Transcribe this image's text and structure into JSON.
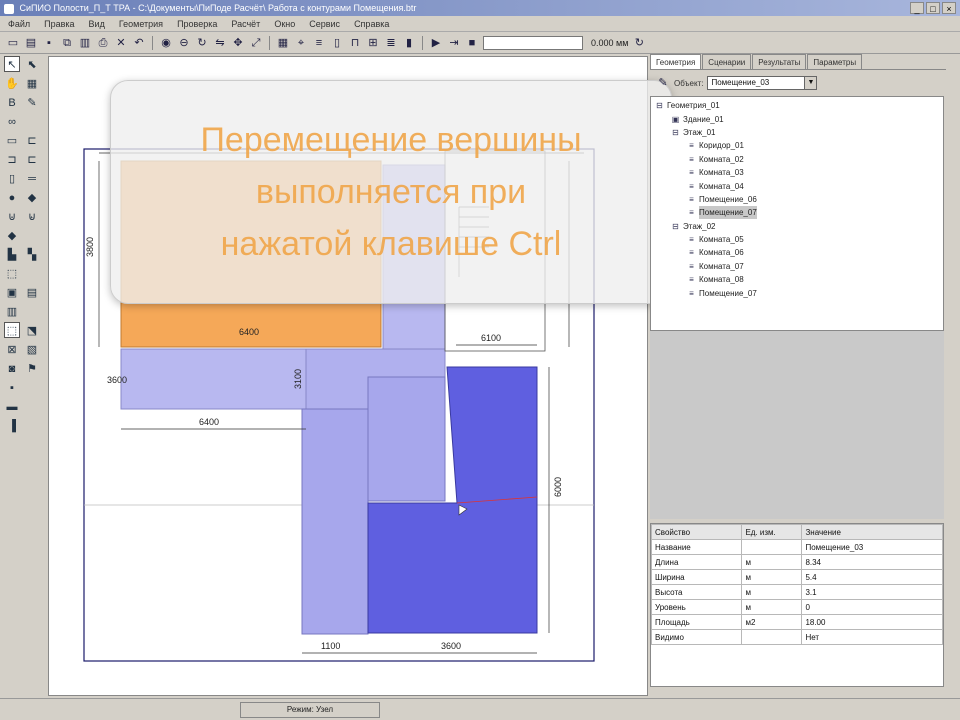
{
  "window": {
    "title": "СиПИО Полости_П_Т ТРА - С:\\Документы\\ПиПоде Расчёт\\ Работа с контурами Помещения.btr",
    "buttons": [
      "_",
      "□",
      "×"
    ]
  },
  "menu": [
    "Файл",
    "Правка",
    "Вид",
    "Геометрия",
    "Проверка",
    "Расчёт",
    "Окно",
    "Сервис",
    "Справка"
  ],
  "toolbar": {
    "icons": [
      "new-icon",
      "open-icon",
      "save-icon",
      "copy-icon",
      "paste-icon",
      "print-icon",
      "delete-icon",
      "undo-icon",
      "circle-icon",
      "ellipse-icon",
      "rotate-icon",
      "mirror-icon",
      "move-icon",
      "scale-icon",
      "grid-icon",
      "snap-icon",
      "align-icon",
      "wall-icon",
      "door-icon",
      "window-icon",
      "stair-icon",
      "column-icon",
      "play-icon",
      "step-icon",
      "stop-icon"
    ],
    "coord_value": "0.000 мм",
    "glyphs": {
      "new-icon": "▭",
      "open-icon": "▤",
      "save-icon": "▪",
      "copy-icon": "⧉",
      "paste-icon": "▥",
      "print-icon": "⎙",
      "delete-icon": "✕",
      "undo-icon": "↶",
      "circle-icon": "◉",
      "ellipse-icon": "⊖",
      "rotate-icon": "↻",
      "mirror-icon": "⇋",
      "move-icon": "✥",
      "scale-icon": "⤢",
      "grid-icon": "▦",
      "snap-icon": "⌖",
      "align-icon": "≡",
      "wall-icon": "▯",
      "door-icon": "⊓",
      "window-icon": "⊞",
      "stair-icon": "≣",
      "column-icon": "▮",
      "play-icon": "▶",
      "step-icon": "⇥",
      "stop-icon": "■"
    }
  },
  "left_tools": [
    {
      "name": "select-arrow-icon",
      "glyph": "↖",
      "active": true
    },
    {
      "name": "node-edit-icon",
      "glyph": "⬉",
      "active": false
    },
    {
      "name": "pan-icon",
      "glyph": "✋",
      "active": false
    },
    {
      "name": "zoom-icon",
      "glyph": "▦",
      "active": false
    },
    {
      "name": "building-icon",
      "glyph": "В",
      "active": false
    },
    {
      "name": "pencil-icon",
      "glyph": "✎",
      "active": false
    },
    {
      "name": "link-icon",
      "glyph": "∞",
      "active": false
    },
    {
      "name": "blank",
      "glyph": "",
      "active": false
    },
    {
      "name": "room-icon",
      "glyph": "▭",
      "active": false
    },
    {
      "name": "zone-icon",
      "glyph": "⊏",
      "active": false
    },
    {
      "name": "wall-tool-icon",
      "glyph": "⊐",
      "active": false
    },
    {
      "name": "contour-icon",
      "glyph": "⊏",
      "active": false
    },
    {
      "name": "column-tool-icon",
      "glyph": "▯",
      "active": false
    },
    {
      "name": "line-tool-icon",
      "glyph": "═",
      "active": false
    },
    {
      "name": "point-icon",
      "glyph": "●",
      "active": false
    },
    {
      "name": "marker-icon",
      "glyph": "◆",
      "active": false
    },
    {
      "name": "door-tool-icon",
      "glyph": "⊍",
      "active": false
    },
    {
      "name": "opening-icon",
      "glyph": "⊌",
      "active": false
    },
    {
      "name": "fill-icon",
      "glyph": "◆",
      "active": false
    },
    {
      "name": "blank2",
      "glyph": "",
      "active": false
    },
    {
      "name": "height-icon",
      "glyph": "▙",
      "active": false
    },
    {
      "name": "level-icon",
      "glyph": "▚",
      "active": false
    },
    {
      "name": "eraser-icon",
      "glyph": "⬚",
      "active": false
    },
    {
      "name": "blank3",
      "glyph": "",
      "active": false
    },
    {
      "name": "calc-icon",
      "glyph": "▣",
      "active": false
    },
    {
      "name": "sensor-icon",
      "glyph": "▤",
      "active": false
    },
    {
      "name": "chart-icon",
      "glyph": "▥",
      "active": false
    },
    {
      "name": "blank4",
      "glyph": "",
      "active": false
    },
    {
      "name": "rect-select-icon",
      "glyph": "⬚",
      "active": true
    },
    {
      "name": "poly-select-icon",
      "glyph": "⬔",
      "active": false
    },
    {
      "name": "fire-icon",
      "glyph": "⊠",
      "active": false
    },
    {
      "name": "exit-icon",
      "glyph": "▧",
      "active": false
    },
    {
      "name": "person-icon",
      "glyph": "◙",
      "active": false
    },
    {
      "name": "flag-icon",
      "glyph": "⚑",
      "active": false
    },
    {
      "name": "info-icon",
      "glyph": "▪",
      "active": false
    },
    {
      "name": "blank5",
      "glyph": "",
      "active": false
    },
    {
      "name": "extra-icon",
      "glyph": "▬",
      "active": false
    },
    {
      "name": "blank6",
      "glyph": "",
      "active": false
    },
    {
      "name": "exit-app-icon",
      "glyph": "▐",
      "active": false
    }
  ],
  "overlay": {
    "lines": [
      "Перемещение вершины",
      "выполняется при",
      "нажатой клавише Ctrl"
    ]
  },
  "dimensions": {
    "d1": "6400",
    "d2": "3800",
    "d3": "6400",
    "d4": "6100",
    "d5": "1100",
    "d6": "3600",
    "d7": "6000",
    "d8": "3600",
    "d9": "3100"
  },
  "right_panel": {
    "tabs": [
      "Геометрия",
      "Сценарии",
      "Результаты",
      "Параметры"
    ],
    "object_label": "Объект:",
    "object_value": "Помещение_03",
    "tree": [
      {
        "level": 0,
        "toggle": "⊟",
        "text": "Геометрия_01",
        "selected": false
      },
      {
        "level": 1,
        "toggle": "",
        "text": "Здание_01",
        "selected": false
      },
      {
        "level": 1,
        "toggle": "⊟",
        "text": "Этаж_01",
        "selected": false
      },
      {
        "level": 2,
        "toggle": "",
        "text": "Коридор_01",
        "selected": false
      },
      {
        "level": 2,
        "toggle": "",
        "text": "Комната_02",
        "selected": false
      },
      {
        "level": 2,
        "toggle": "",
        "text": "Комната_03",
        "selected": false
      },
      {
        "level": 2,
        "toggle": "",
        "text": "Комната_04",
        "selected": false
      },
      {
        "level": 2,
        "toggle": "",
        "text": "Помещение_06",
        "selected": false
      },
      {
        "level": 2,
        "toggle": "",
        "text": "Помещение_07",
        "selected": true
      },
      {
        "level": 1,
        "toggle": "⊟",
        "text": "Этаж_02",
        "selected": false
      },
      {
        "level": 2,
        "toggle": "",
        "text": "Комната_05",
        "selected": false
      },
      {
        "level": 2,
        "toggle": "",
        "text": "Комната_06",
        "selected": false
      },
      {
        "level": 2,
        "toggle": "",
        "text": "Комната_07",
        "selected": false
      },
      {
        "level": 2,
        "toggle": "",
        "text": "Комната_08",
        "selected": false
      },
      {
        "level": 2,
        "toggle": "",
        "text": "Помещение_07",
        "selected": false
      }
    ],
    "props_header": [
      "Свойство",
      "Ед. изм.",
      "Значение"
    ],
    "props_rows": [
      [
        "Название",
        "",
        "Помещение_03"
      ],
      [
        "Длина",
        "м",
        "8.34"
      ],
      [
        "Ширина",
        "м",
        "5.4"
      ],
      [
        "Высота",
        "м",
        "3.1"
      ],
      [
        "Уровень",
        "м",
        "0"
      ],
      [
        "Площадь",
        "м2",
        "18.00"
      ],
      [
        "Видимо",
        "",
        "Нет"
      ]
    ]
  },
  "status": {
    "text": "Режим: Узел"
  },
  "colors": {
    "orange_room": "#f5a858",
    "light_room": "#b8b8f0",
    "mid_room": "#a7a7ec",
    "dark_room": "#5f5fe0",
    "overlay_text": "#f0a64a"
  }
}
